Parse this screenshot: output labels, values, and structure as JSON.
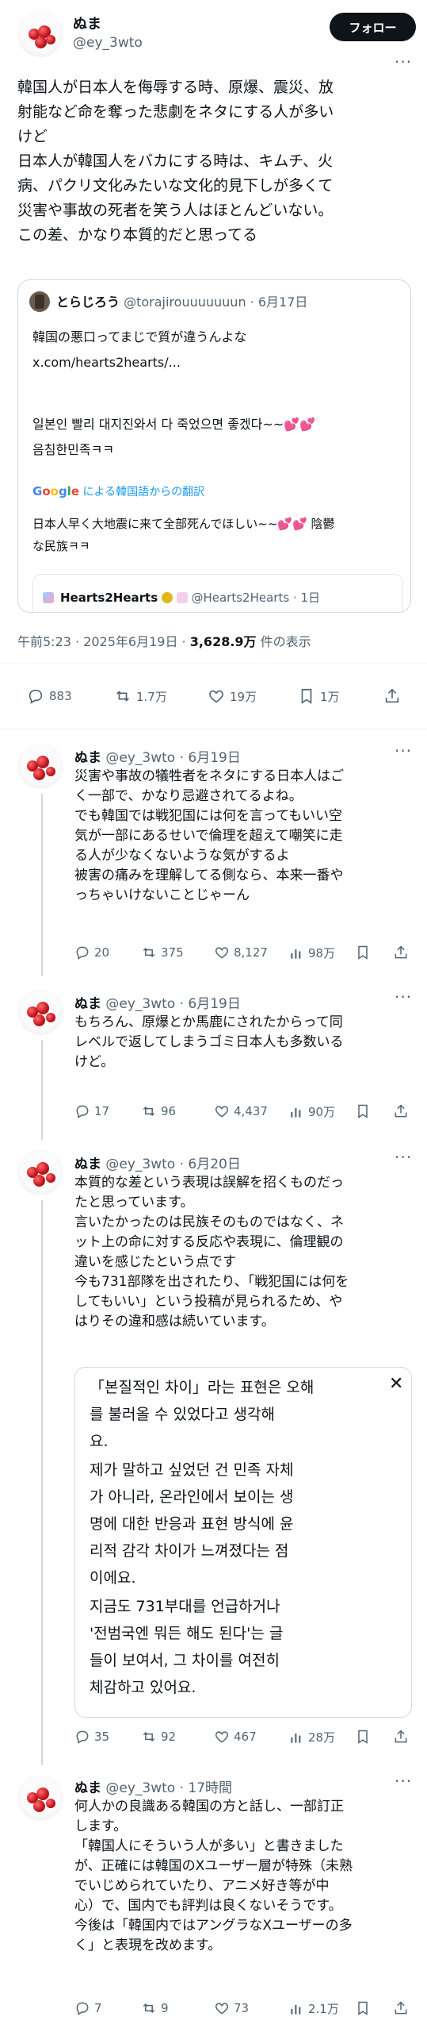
{
  "main_tweet": {
    "display_name": "ぬま",
    "handle": "@ey_3wto",
    "follow_label": "フォロー",
    "text_lines": [
      "韓国人が日本人を侮辱する時、原爆、震災、放",
      "射能など命を奪った悲劇をネタにする人が多い",
      "けど",
      "日本人が韓国人をバカにする時は、キムチ、火",
      "病、パクリ文化みたいな文化的見下しが多くて",
      "災害や事故の死者を笑う人はほとんどいない。",
      "この差、かなり本質的だと思ってる"
    ],
    "timestamp": "午前5:23 · 2025年6月19日 · ",
    "views_count": "3,628.9万",
    "views_suffix": " 件の表示",
    "replies": "883",
    "retweets": "1.7万",
    "likes": "19万",
    "bookmarks": "1万"
  },
  "quoted_tweet": {
    "display_name": "とらじろう",
    "handle": "@torajirouuuuuuun",
    "date": "· 6月17日",
    "lines": [
      "韓国の悪口ってまじで質が違うんよな",
      "x.com/hearts2hearts/...",
      "",
      "일본인 빨리 대지진와서 다 죽었으면 좋겠다~~💕💕",
      "음침한민족ㅋㅋ"
    ],
    "translation_brand": "Google",
    "translation_label": "による韓国語からの翻訳",
    "translated_lines": [
      "日本人早く大地震に来て全部死んでほしい~~💕💕 陰鬱",
      "な民族ㅋㅋ"
    ],
    "nested_name": "Hearts2Hearts",
    "nested_handle": "@Hearts2Hearts · 1日"
  },
  "replies": [
    {
      "display_name": "ぬま",
      "handle": "@ey_3wto · 6月19日",
      "lines": [
        "災害や事故の犠牲者をネタにする日本人はご",
        "く一部で、かなり忌避されてるよね。",
        "でも韓国では戦犯国には何を言ってもいい空",
        "気が一部にあるせいで倫理を超えて嘲笑に走",
        "る人が少なくないような気がするよ",
        "被害の痛みを理解してる側なら、本来一番や",
        "っちゃいけないことじゃーん"
      ],
      "replies": "20",
      "retweets": "375",
      "likes": "8,127",
      "views": "98万"
    },
    {
      "display_name": "ぬま",
      "handle": "@ey_3wto · 6月19日",
      "lines": [
        "もちろん、原爆とか馬鹿にされたからって同",
        "レベルで返してしまうゴミ日本人も多数いる",
        "けど。"
      ],
      "replies": "17",
      "retweets": "96",
      "likes": "4,437",
      "views": "90万"
    },
    {
      "display_name": "ぬま",
      "handle": "@ey_3wto · 6月20日",
      "lines": [
        "本質的な差という表現は誤解を招くものだっ",
        "たと思っています。",
        "言いたかったのは民族そのものではなく、ネ",
        "ット上の命に対する反応や表現に、倫理観の",
        "違いを感じたという点です",
        "今も731部隊を出されたり、「戦犯国には何を",
        "してもいい」という投稿が見られるため、や",
        "はりその違和感は続いています。"
      ],
      "korean_lines": [
        "「본질적인 차이」라는 표현은 오해",
        "를 불러올 수 있었다고 생각해",
        "요.",
        "제가 말하고 싶었던 건 민족 자체",
        "가 아니라, 온라인에서 보이는 생",
        "명에 대한 반응과 표현 방식에 윤",
        "리적 감각 차이가 느껴졌다는 점",
        "이에요.",
        "지금도 731부대를 언급하거나",
        "'전범국엔 뭐든 해도 된다'는 글",
        "들이 보여서, 그 차이를 여전히",
        "체감하고 있어요."
      ],
      "replies": "35",
      "retweets": "92",
      "likes": "467",
      "views": "28万"
    },
    {
      "display_name": "ぬま",
      "handle": "@ey_3wto · 17時間",
      "lines": [
        "何人かの良識ある韓国の方と話し、一部訂正",
        "します。",
        "「韓国人にそういう人が多い」と書きました",
        "が、正確には韓国のXユーザー層が特殊（未熟",
        "でいじめられていたり、アニメ好き等が中",
        "心）で、国内でも評判は良くないそうです。",
        "今後は「韓国内ではアングラなXユーザーの多",
        "く」と表現を改めます。"
      ],
      "replies": "7",
      "retweets": "9",
      "likes": "73",
      "views": "2.1万"
    }
  ],
  "colors": {
    "text": "#0f1419",
    "muted": "#536471",
    "border": "#cfd9de",
    "google_blue": "#4285F4"
  }
}
